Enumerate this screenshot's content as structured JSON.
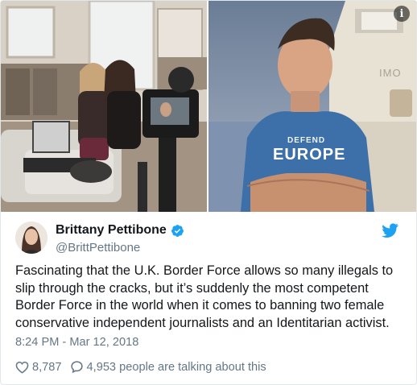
{
  "tweet": {
    "display_name": "Brittany Pettibone",
    "handle": "@BrittPettibone",
    "verified": true,
    "text_lines": [
      "Fascinating that the U.K. Border Force allows so many illegals to",
      "slip through the cracks, but it’s suddenly the most competent",
      "Border Force in the world when it comes to banning two female",
      "conservative independent journalists and an Identitarian activist."
    ],
    "timestamp": "8:24 PM - Mar 12, 2018",
    "likes": "8,787",
    "replies_text": "4,953 people are talking about this"
  },
  "media": {
    "left_photo_label": "",
    "shirt_text_top": "DEFEND",
    "shirt_text_main": "EUROPE",
    "ship_sign": "IMO"
  },
  "icons": {
    "info": "info-icon",
    "verified": "verified-badge-icon",
    "platform": "twitter-bird-icon",
    "like": "heart-icon",
    "reply": "speech-bubble-icon"
  },
  "colors": {
    "brand_blue": "#1da1f2",
    "text_primary": "#14171a",
    "text_secondary": "#657786",
    "border": "#e1e8ed"
  }
}
